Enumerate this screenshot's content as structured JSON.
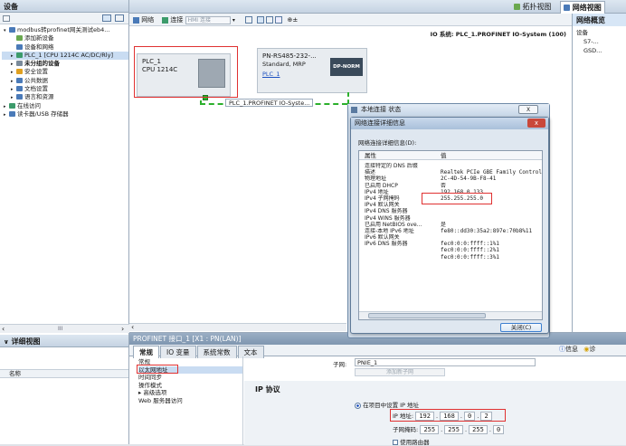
{
  "left_panel": {
    "title": "设备",
    "tree": [
      {
        "label": "modbus转profinet网关测试eb4...",
        "level": 0,
        "icon_color": "#4a7ab8"
      },
      {
        "label": "添加新设备",
        "level": 1,
        "icon_color": "#6aa84f"
      },
      {
        "label": "设备和网络",
        "level": 1,
        "icon_color": "#4a7ab8"
      },
      {
        "label": "PLC_1 [CPU 1214C AC/DC/Rly]",
        "level": 1,
        "icon_color": "#3c9b6b",
        "selected": true
      },
      {
        "label": "未分组的设备",
        "level": 1,
        "icon_color": "#7a8a9a",
        "bold": true
      },
      {
        "label": "安全设置",
        "level": 1,
        "icon_color": "#e0a020"
      },
      {
        "label": "公共数据",
        "level": 1,
        "icon_color": "#4a7ab8"
      },
      {
        "label": "文档设置",
        "level": 1,
        "icon_color": "#4a7ab8"
      },
      {
        "label": "语言和资源",
        "level": 1,
        "icon_color": "#4a7ab8"
      },
      {
        "label": "在线访问",
        "level": 0,
        "icon_color": "#3c9b6b"
      },
      {
        "label": "读卡器/USB 存储器",
        "level": 0,
        "icon_color": "#4a7ab8"
      }
    ],
    "scroll_mid": "III",
    "detail_title": "详细视图",
    "detail_col": "名称"
  },
  "top_right": {
    "topo_view": "拓扑视图",
    "net_view": "网络视图",
    "overview": "网络概览",
    "overview_items": [
      "设备",
      "S7-...",
      "GSD..."
    ]
  },
  "toolbar": {
    "network": "网络",
    "connect": "连接",
    "hmi": "HMI 连接"
  },
  "io_system": "IO 系统: PLC_1.PROFINET IO-System (100)",
  "plc": {
    "name": "PLC_1",
    "model": "CPU 1214C"
  },
  "gateway": {
    "name": "PN-RS485-232-...",
    "mode": "Standard, MRP",
    "link": "PLC_1",
    "chip": "DP-NORM"
  },
  "profinet_label": "PLC_1.PROFINET IO-Syste...",
  "status_dialog": {
    "title": "本地连接 状态",
    "close": "X"
  },
  "detail_dialog": {
    "title": "网络连接详细信息",
    "subtitle": "网络连接详细信息(D):",
    "col_prop": "属性",
    "col_val": "值",
    "rows": [
      {
        "k": "连接特定的 DNS 后缀",
        "v": ""
      },
      {
        "k": "描述",
        "v": "Realtek PCIe GBE Family Controlle"
      },
      {
        "k": "物理地址",
        "v": "2C-4D-54-9B-F8-41"
      },
      {
        "k": "已启用 DHCP",
        "v": "否"
      },
      {
        "k": "IPv4 地址",
        "v": "192.168.0.133"
      },
      {
        "k": "IPv4 子网掩码",
        "v": "255.255.255.0"
      },
      {
        "k": "IPv4 默认网关",
        "v": ""
      },
      {
        "k": "IPv4 DNS 服务器",
        "v": ""
      },
      {
        "k": "IPv4 WINS 服务器",
        "v": ""
      },
      {
        "k": "已启用 NetBIOS ove...",
        "v": "是"
      },
      {
        "k": "连接-本地 IPv6 地址",
        "v": "fe80::dd30:35a2:897e:70b8%11"
      },
      {
        "k": "IPv6 默认网关",
        "v": ""
      },
      {
        "k": "IPv6 DNS 服务器",
        "v": "fec0:0:0:ffff::1%1"
      },
      {
        "k": "",
        "v": "fec0:0:0:ffff::2%1"
      },
      {
        "k": "",
        "v": "fec0:0:0:ffff::3%1"
      }
    ],
    "close_btn": "关闭(C)"
  },
  "bottom": {
    "panel_title": "PROFINET 接口_1 [X1 : PN(LAN)]",
    "tabs": [
      "常规",
      "IO 变量",
      "系统常数",
      "文本"
    ],
    "nav": [
      "常规",
      "以太网地址",
      "时间同步",
      "操作模式",
      "▸ 高级选项",
      "Web 服务器访问"
    ],
    "subnet_label": "子网:",
    "subnet_value": "PNIE_1",
    "add_subnet": "添加新子网",
    "ip_section": "IP 协议",
    "radio_label": "在项目中设置 IP 地址",
    "ip_label": "IP 地址:",
    "ip": [
      "192",
      "168",
      "0",
      "2"
    ],
    "mask_label": "子网掩码:",
    "mask": [
      "255",
      "255",
      "255",
      "0"
    ],
    "router_label": "使用路由器",
    "info_tabs": [
      "信息",
      "诊"
    ]
  }
}
